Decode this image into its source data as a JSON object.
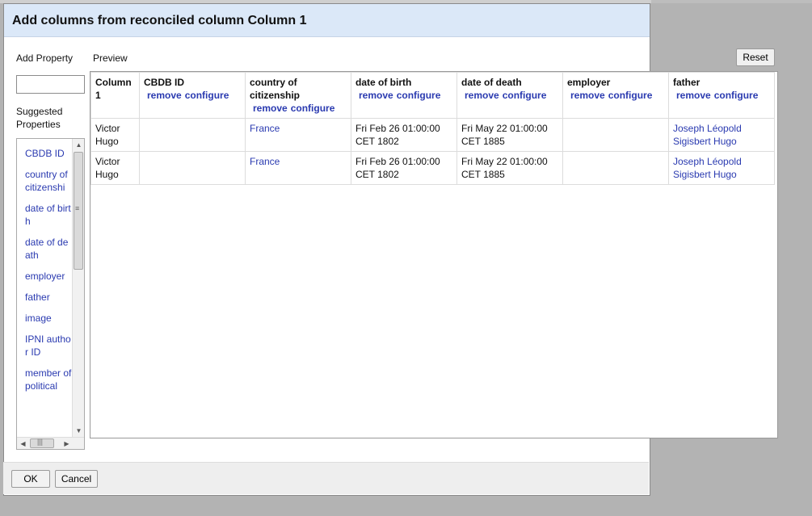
{
  "dialog": {
    "title": "Add columns from reconciled column Column 1",
    "add_property_label": "Add Property",
    "property_input_value": "",
    "suggested_label": "Suggested Properties",
    "preview_label": "Preview",
    "reset_label": "Reset",
    "ok_label": "OK",
    "cancel_label": "Cancel"
  },
  "suggested_properties": [
    "CBDB ID",
    "country of citizenshi",
    "date of birth",
    "date of death",
    "employer",
    "father",
    "image",
    "IPNI author ID",
    "member of political"
  ],
  "scroll_glyphs": {
    "up": "▲",
    "down": "▼",
    "left": "◀",
    "right": "▶",
    "grip_v": "≡",
    "grip_h": "|||"
  },
  "preview": {
    "columns": [
      {
        "name": "Column 1",
        "removable": false
      },
      {
        "name": "CBDB ID",
        "removable": true
      },
      {
        "name": "country of citizenship",
        "removable": true
      },
      {
        "name": "date of birth",
        "removable": true
      },
      {
        "name": "date of death",
        "removable": true
      },
      {
        "name": "employer",
        "removable": true
      },
      {
        "name": "father",
        "removable": true
      }
    ],
    "remove_label": "remove",
    "configure_label": "configure",
    "rows": [
      [
        "Victor Hugo",
        "",
        "France",
        "Fri Feb 26 01:00:00 CET 1802",
        "Fri May 22 01:00:00 CET 1885",
        "",
        "Joseph Léopold Sigisbert Hugo"
      ],
      [
        "Victor Hugo",
        "",
        "France",
        "Fri Feb 26 01:00:00 CET 1802",
        "Fri May 22 01:00:00 CET 1885",
        "",
        "Joseph Léopold Sigisbert Hugo"
      ]
    ],
    "link_columns": [
      2,
      6
    ]
  },
  "colors": {
    "header_bg": "#dbe8f8",
    "link": "#2a3ab0",
    "overlay": "#b3b3b3"
  }
}
